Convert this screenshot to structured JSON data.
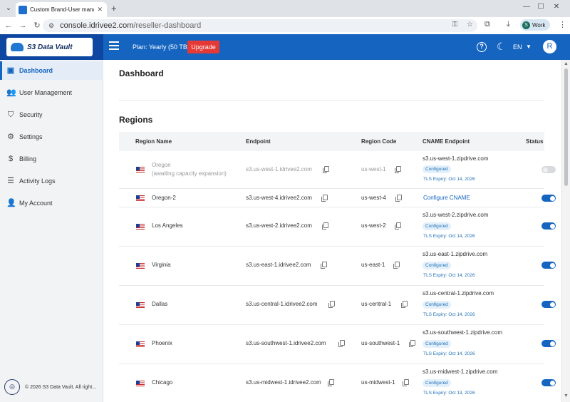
{
  "browser": {
    "tab_title": "Custom Brand-User management",
    "url_host": "console.idrivee2.com",
    "url_path": "/reseller-dashboard",
    "profile_initial": "S",
    "profile_label": "Work"
  },
  "header": {
    "logo_text": "S3 Data Vault",
    "plan": "Plan: Yearly (50 TB)",
    "upgrade_label": "Upgrade",
    "language": "EN",
    "avatar_initial": "R"
  },
  "sidebar": {
    "items": [
      {
        "label": "Dashboard",
        "icon": "dashboard-icon",
        "active": true
      },
      {
        "label": "User Management",
        "icon": "users-icon"
      },
      {
        "label": "Security",
        "icon": "shield-icon"
      },
      {
        "label": "Settings",
        "icon": "gear-icon"
      },
      {
        "label": "Billing",
        "icon": "billing-icon"
      },
      {
        "label": "Activity Logs",
        "icon": "activity-icon"
      },
      {
        "label": "My Account",
        "icon": "account-icon"
      }
    ],
    "footer": "© 2026 S3 Data Vault. All right..."
  },
  "main": {
    "page_title": "Dashboard",
    "section_title": "Regions",
    "columns": [
      "Region Name",
      "Endpoint",
      "Region Code",
      "CNAME Endpoint",
      "Status"
    ],
    "rows": [
      {
        "name": "Oregon",
        "subtitle": "(awaiting capacity expansion)",
        "endpoint": "s3.us-west-1.idrivee2.com",
        "code": "us-west-1",
        "cname": "s3.us-west-1.zipdrive.com",
        "badge": "Configured",
        "tls": "TLS Expiry: Oct 14, 2026",
        "enabled": false
      },
      {
        "name": "Oregon-2",
        "endpoint": "s3.us-west-4.idrivee2.com",
        "code": "us-west-4",
        "cname_link": "Configure CNAME",
        "enabled": true
      },
      {
        "name": "Los Angeles",
        "endpoint": "s3.us-west-2.idrivee2.com",
        "code": "us-west-2",
        "cname": "s3.us-west-2.zipdrive.com",
        "badge": "Configured",
        "tls": "TLS Expiry: Oct 14, 2026",
        "enabled": true
      },
      {
        "name": "Virginia",
        "endpoint": "s3.us-east-1.idrivee2.com",
        "code": "us-east-1",
        "cname": "s3.us-east-1.zipdrive.com",
        "badge": "Configured",
        "tls": "TLS Expiry: Oct 14, 2026",
        "enabled": true
      },
      {
        "name": "Dallas",
        "endpoint": "s3.us-central-1.idrivee2.com",
        "code": "us-central-1",
        "cname": "s3.us-central-1.zipdrive.com",
        "badge": "Configured",
        "tls": "TLS Expiry: Oct 14, 2026",
        "enabled": true
      },
      {
        "name": "Phoenix",
        "endpoint": "s3.us-southwest-1.idrivee2.com",
        "code": "us-southwest-1",
        "cname": "s3.us-southwest-1.zipdrive.com",
        "badge": "Configured",
        "tls": "TLS Expiry: Oct 14, 2026",
        "enabled": true
      },
      {
        "name": "Chicago",
        "endpoint": "s3.us-midwest-1.idrivee2.com",
        "code": "us-midwest-1",
        "cname": "s3.us-midwest-1.zipdrive.com",
        "badge": "Configured",
        "tls": "TLS Expiry: Oct 13, 2026",
        "enabled": true
      }
    ]
  },
  "colors": {
    "header": "#1565c0",
    "logo_bg": "#0d47a1",
    "upgrade": "#e53935",
    "toggle_on": "#1565c0"
  }
}
